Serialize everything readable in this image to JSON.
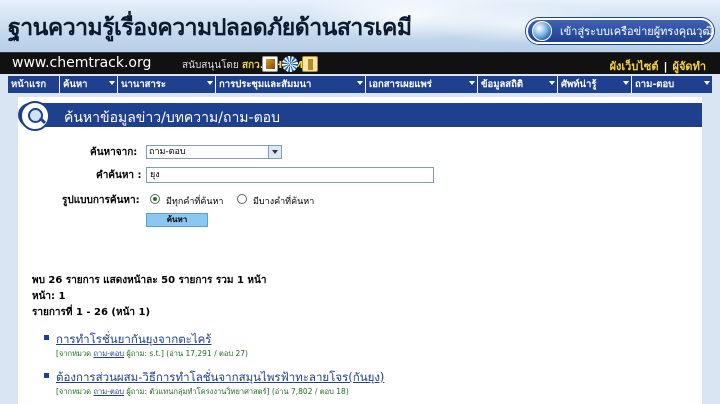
{
  "header": {
    "site_title": "ฐานความรู้เรื่องความปลอดภัยด้านสารเคมี",
    "network_link": "เข้าสู่ระบบเครือข่ายผู้ทรงคุณวุฒิ",
    "site_url": "www.chemtrack.org",
    "sponsor_prefix": "สนับสนุนโดย",
    "sponsor_org": "สกว. EHWM",
    "sitemap_link": "ผังเว็บไซต์",
    "admin_link": "ผู้จัดทำ"
  },
  "nav": [
    {
      "label": "หน้าแรก",
      "dropdown": false
    },
    {
      "label": "ค้นหา",
      "dropdown": true
    },
    {
      "label": "นานาสาระ",
      "dropdown": true
    },
    {
      "label": "การประชุมและสัมมนา",
      "dropdown": true
    },
    {
      "label": "เอกสารเผยแพร่",
      "dropdown": true
    },
    {
      "label": "ข้อมูลสถิติ",
      "dropdown": true
    },
    {
      "label": "ศัพท์น่ารู้",
      "dropdown": true
    },
    {
      "label": "ถาม-ตอบ",
      "dropdown": true
    }
  ],
  "section_title": "ค้นหาข้อมูลข่าว/บทความ/ถาม-ตอบ",
  "form": {
    "source_label": "ค้นหาจาก:",
    "source_value": "ถาม-ตอบ",
    "keyword_label": "คำค้นหา :",
    "keyword_value": "ยุง",
    "mode_label": "รูปแบบการค้นหา:",
    "mode_all": "มีทุกคำที่ค้นหา",
    "mode_any": "มีบางคำที่ค้นหา",
    "search_button": "ค้นหา"
  },
  "summary": {
    "line1": "พบ 26 รายการ  แสดงหน้าละ 50 รายการ รวม 1 หน้า",
    "line2": "หน้า:  1",
    "line3": "รายการที่ 1 - 26 (หน้า 1)"
  },
  "results": [
    {
      "title": "การทำโรชั่นยากันยุงจากตะไคร้",
      "meta_prefix": "[จากหมวด ",
      "category": "ถาม-ตอบ",
      "meta_rest": " ผู้ถาม: s.t.] (อ่าน 17,291 / ตอบ 27)"
    },
    {
      "title": "ต้องการส่วนผสม-วิธีการทำโลชั่นจากสมุนไพรฟ้าทะลายโจร(กันยุง)",
      "meta_prefix": "[จากหมวด ",
      "category": "ถาม-ตอบ",
      "meta_rest": " ผู้ถาม: ตัวแทนกลุ่มทำโครงงานวิทยาศาสตร์] (อ่าน 7,802 / ตอบ 18)"
    }
  ]
}
